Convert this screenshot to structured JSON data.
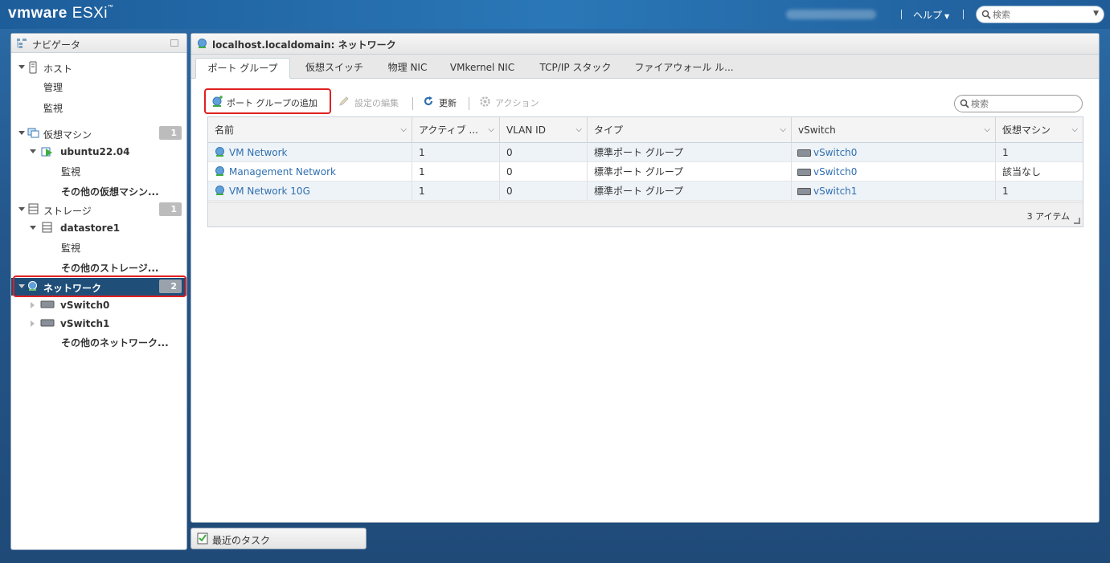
{
  "header": {
    "brand": "vmware",
    "product": "ESXi",
    "help_label": "ヘルプ",
    "search_placeholder": "検索"
  },
  "navigator": {
    "title": "ナビゲータ",
    "items": [
      {
        "label": "ホスト"
      },
      {
        "label": "管理"
      },
      {
        "label": "監視"
      },
      {
        "label": "仮想マシン",
        "badge": "1"
      },
      {
        "label": "ubuntu22.04"
      },
      {
        "label": "監視"
      },
      {
        "label": "その他の仮想マシン..."
      },
      {
        "label": "ストレージ",
        "badge": "1"
      },
      {
        "label": "datastore1"
      },
      {
        "label": "監視"
      },
      {
        "label": "その他のストレージ..."
      },
      {
        "label": "ネットワーク",
        "badge": "2"
      },
      {
        "label": "vSwitch0"
      },
      {
        "label": "vSwitch1"
      },
      {
        "label": "その他のネットワーク..."
      }
    ]
  },
  "main": {
    "title": "localhost.localdomain: ネットワーク",
    "tabs": [
      {
        "label": "ポート グループ"
      },
      {
        "label": "仮想スイッチ"
      },
      {
        "label": "物理 NIC"
      },
      {
        "label": "VMkernel NIC"
      },
      {
        "label": "TCP/IP スタック"
      },
      {
        "label": "ファイアウォール ル..."
      }
    ],
    "toolbar": {
      "add": "ポート グループの追加",
      "edit": "設定の編集",
      "refresh": "更新",
      "actions": "アクション",
      "search_placeholder": "検索"
    },
    "grid": {
      "columns": [
        "名前",
        "アクティブ ...",
        "VLAN ID",
        "タイプ",
        "vSwitch",
        "仮想マシン"
      ],
      "rows": [
        {
          "name": "VM Network",
          "active": "1",
          "vlan": "0",
          "type": "標準ポート グループ",
          "vswitch": "vSwitch0",
          "vms": "1"
        },
        {
          "name": "Management Network",
          "active": "1",
          "vlan": "0",
          "type": "標準ポート グループ",
          "vswitch": "vSwitch0",
          "vms": "該当なし"
        },
        {
          "name": "VM Network 10G",
          "active": "1",
          "vlan": "0",
          "type": "標準ポート グループ",
          "vswitch": "vSwitch1",
          "vms": "1"
        }
      ],
      "footer_count": "3 アイテム"
    }
  },
  "tasks": {
    "label": "最近のタスク"
  },
  "colors": {
    "accent": "#1f4e79",
    "link": "#2f6fb0",
    "highlight": "#e02020"
  }
}
